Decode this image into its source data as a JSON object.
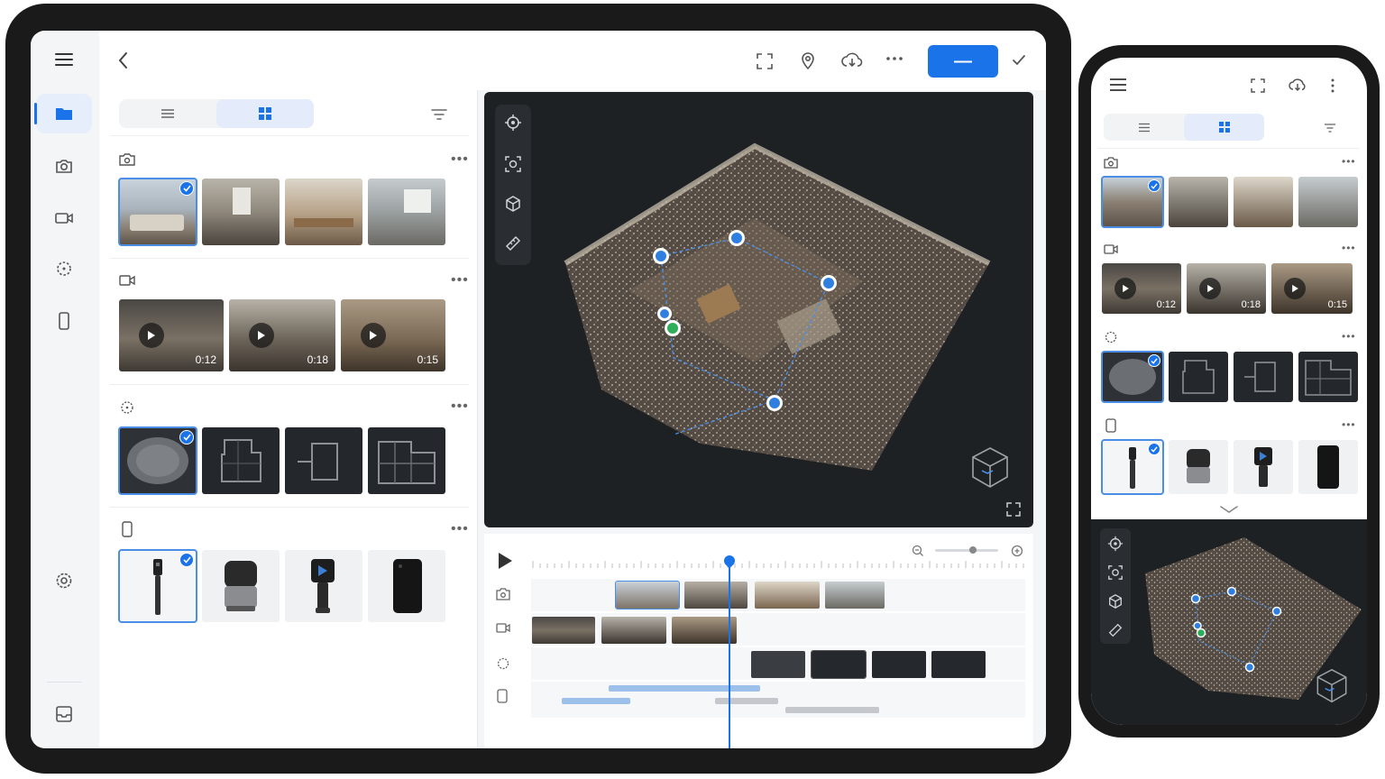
{
  "tablet": {
    "topbar": {
      "back_icon": "chevron-left-icon",
      "icons": [
        "fullscreen-icon",
        "location-pin-icon",
        "cloud-download-icon",
        "more-horizontal-icon"
      ],
      "primary_button_label": "—",
      "confirm_icon": "check-icon"
    },
    "rail": {
      "items": [
        "menu-icon",
        "folder-icon",
        "camera-icon",
        "video-icon",
        "pointcloud-icon",
        "device-icon",
        "settings-icon",
        "inbox-icon"
      ],
      "active": "folder-icon"
    },
    "media_panel": {
      "view_toggle": [
        "list-view-icon",
        "grid-view-icon"
      ],
      "active_view": "grid",
      "sections": [
        {
          "icon": "camera-icon",
          "count": 4,
          "selected_index": 0
        },
        {
          "icon": "video-icon",
          "durations": [
            "0:12",
            "0:18",
            "0:15"
          ]
        },
        {
          "icon": "pointcloud-icon",
          "count": 4,
          "selected_index": 0
        },
        {
          "icon": "device-icon",
          "count": 4,
          "selected_index": 0
        }
      ]
    },
    "viewer": {
      "tools": [
        "target-icon",
        "scan-icon",
        "cube-icon",
        "ruler-icon"
      ],
      "nav_cube_icon": "view-cube-icon",
      "expand_icon": "expand-icon"
    },
    "timeline": {
      "play_icon": "play-icon",
      "zoom_out_icon": "zoom-out-icon",
      "zoom_in_icon": "zoom-in-icon",
      "zoom_level": 0.6,
      "playhead_fraction": 0.4,
      "tracks": [
        "camera-icon",
        "video-icon",
        "pointcloud-icon",
        "device-icon"
      ]
    }
  },
  "phone": {
    "topbar_icons": [
      "menu-icon",
      "fullscreen-icon",
      "cloud-download-icon",
      "more-vertical-icon"
    ],
    "durations": [
      "0:12",
      "0:18",
      "0:15"
    ],
    "viewer_tools": [
      "target-icon",
      "scan-icon",
      "cube-icon",
      "ruler-icon"
    ]
  },
  "colors": {
    "accent": "#1a73e8",
    "viewer_bg": "#1e2124",
    "selected_bg": "#e4ecfb"
  }
}
